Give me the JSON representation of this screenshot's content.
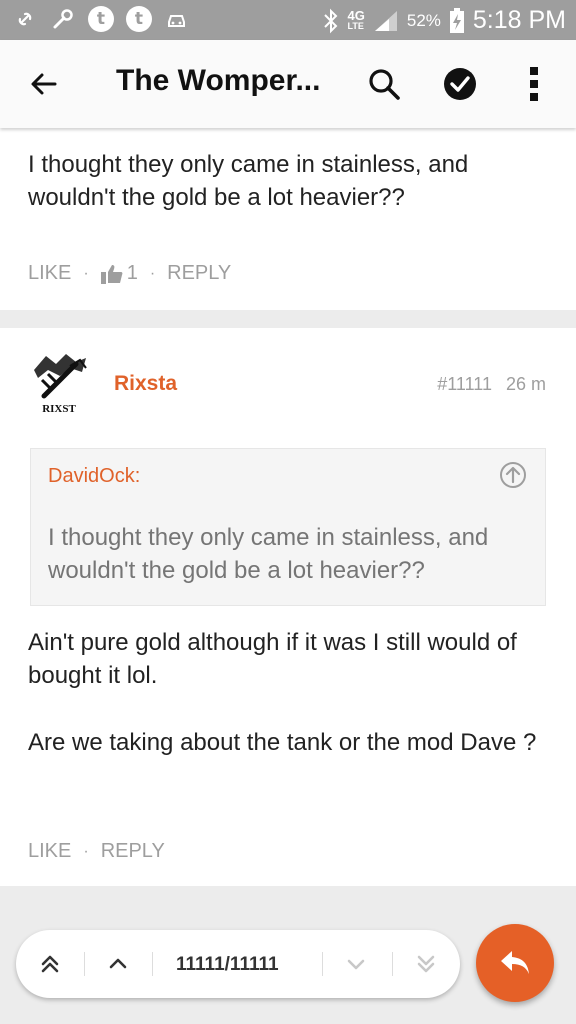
{
  "status_bar": {
    "battery": "52%",
    "network": "4G",
    "network_sub": "LTE",
    "time": "5:18 PM",
    "notification_icons": [
      "link-icon",
      "wrench-icon",
      "tumblr-icon",
      "tumblr-icon",
      "car-icon"
    ]
  },
  "app_bar": {
    "title": "The Womper...",
    "icons": [
      "back-arrow-icon",
      "search-icon",
      "check-circle-icon",
      "more-vert-icon"
    ]
  },
  "posts": [
    {
      "text": "I thought they only came in stainless, and wouldn't the gold be a lot heavier??",
      "actions": {
        "like": "LIKE",
        "like_count": "1",
        "reply": "REPLY"
      }
    },
    {
      "author": "Rixsta",
      "post_number": "#11111",
      "time_ago": "26 m",
      "avatar_text": "RIXST",
      "quote": {
        "author": "DavidOck:",
        "text": "I thought they only came in stainless, and wouldn't the gold be a lot heavier??"
      },
      "paragraphs": [
        "Ain't pure gold although if it was I still would of bought it lol.",
        "Are we taking about the tank or the mod Dave ?"
      ],
      "actions": {
        "like": "LIKE",
        "reply": "REPLY"
      }
    }
  ],
  "pager": {
    "position": "11111/11111"
  },
  "colors": {
    "accent": "#e0622a",
    "fab": "#e56027",
    "status_bar": "#9e9e9e"
  }
}
